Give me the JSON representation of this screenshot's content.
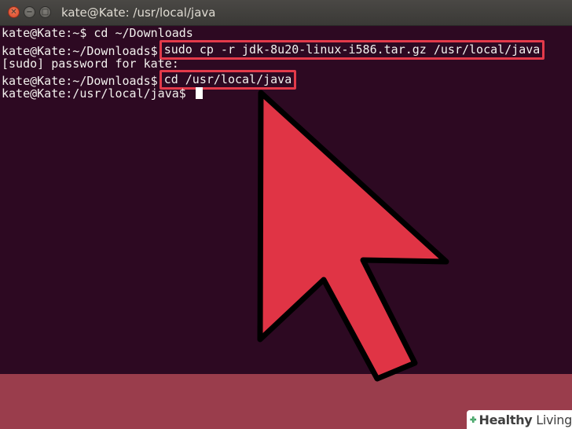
{
  "window": {
    "title": "kate@Kate: /usr/local/java",
    "close_glyph": "✕",
    "minimize_glyph": "−",
    "maximize_glyph": "□"
  },
  "terminal": {
    "lines": [
      {
        "prompt": "kate@Kate:~$ ",
        "command": "cd ~/Downloads",
        "highlighted": false
      },
      {
        "prompt": "kate@Kate:~/Downloads$",
        "command": "sudo cp -r jdk-8u20-linux-i586.tar.gz /usr/local/java",
        "highlighted": true
      },
      {
        "output": "[sudo] password for kate:"
      },
      {
        "prompt": "kate@Kate:~/Downloads$",
        "command": "cd /usr/local/java",
        "highlighted": true
      },
      {
        "prompt": "kate@Kate:/usr/local/java$ ",
        "command": "",
        "cursor": true
      }
    ]
  },
  "colors": {
    "terminal_bg": "#2d0922",
    "highlight_border": "#e33a4a",
    "arrow_fill": "#e03445",
    "arrow_stroke": "#000000",
    "overlay": "#9a3d4c"
  },
  "watermark": {
    "bold": "Healthy",
    "rest": "Living",
    "icon": "green-cross-icon"
  }
}
